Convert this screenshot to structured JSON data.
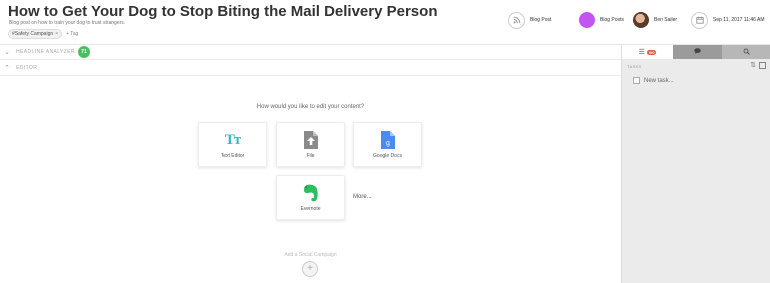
{
  "header": {
    "title": "How to Get Your Dog to Stop Biting the Mail Delivery Person",
    "subtitle": "Blog post on how to train your dog to trust strangers.",
    "tags": [
      {
        "label": "#Safety Campaign",
        "remove": "×"
      }
    ],
    "add_tag": "+ Tag",
    "type_label": "Blog Post",
    "project_label": "Blog Posts",
    "project_color": "#c254f0",
    "user_name": "Ben Sailer",
    "date": "Sep 11, 2017 11:46 AM"
  },
  "panels": {
    "headline_analyzer": "HEADLINE ANALYZER",
    "headline_score": "71",
    "score_color": "#47c05f",
    "editor": "EDITOR"
  },
  "editor_choice": {
    "prompt": "How would you like to edit your content?",
    "options": [
      {
        "label": "Text Editor",
        "icon": "text-editor-icon",
        "glyph": "Tт"
      },
      {
        "label": "File",
        "icon": "file-upload-icon"
      },
      {
        "label": "Google Docs",
        "icon": "google-docs-icon"
      },
      {
        "label": "Evernote",
        "icon": "evernote-icon"
      }
    ],
    "more": "More...",
    "social_label": "Add a Social Campaign",
    "social_add": "+"
  },
  "sidebar": {
    "tasks_count": "0/0",
    "tasks_header": "TASKS",
    "sort_glyph": "⇅",
    "new_task": "New task..."
  }
}
